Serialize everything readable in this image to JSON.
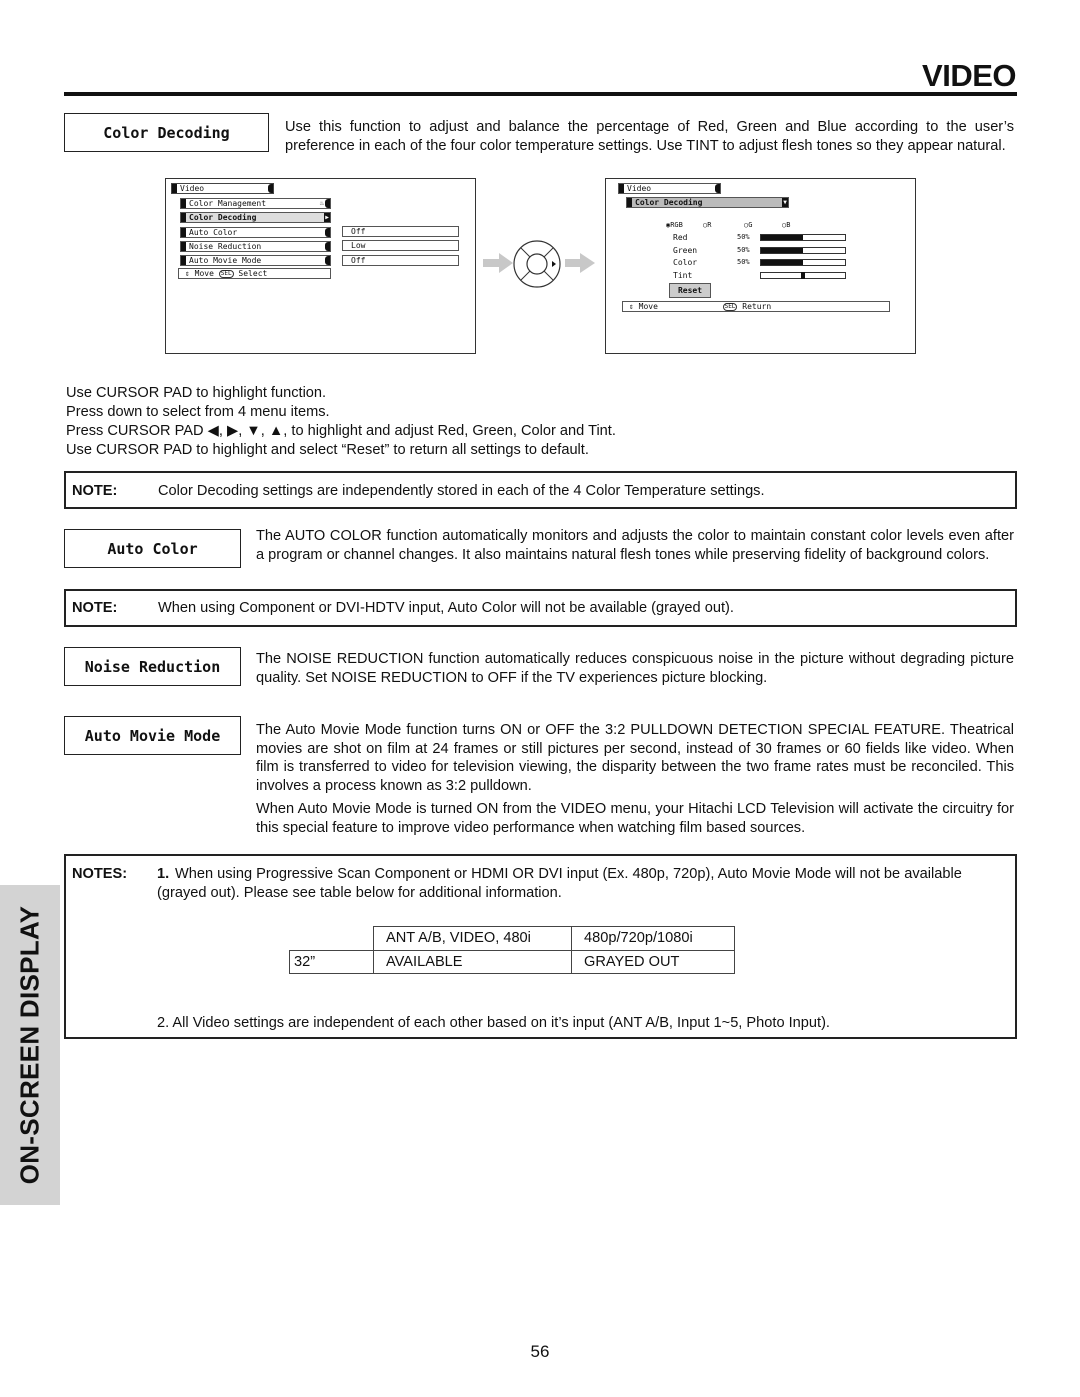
{
  "header": {
    "title": "VIDEO"
  },
  "side_tab": {
    "label": "ON-SCREEN DISPLAY"
  },
  "page_number": "56",
  "sections": {
    "color_decoding": {
      "label": "Color Decoding",
      "description": "Use this function to adjust and balance the percentage of Red, Green and Blue according to the user’s preference in each of the four color temperature settings.  Use TINT to adjust flesh tones so they appear natural."
    },
    "auto_color": {
      "label": "Auto Color",
      "description": "The AUTO COLOR function automatically monitors and adjusts the color to maintain constant color levels even after a program or channel changes. It also maintains natural flesh tones while preserving fidelity of background colors."
    },
    "noise_reduction": {
      "label": "Noise Reduction",
      "description": "The NOISE REDUCTION function automatically reduces conspicuous noise in the picture without degrading picture quality.  Set NOISE REDUCTION to OFF if the TV experiences picture blocking."
    },
    "auto_movie_mode": {
      "label": "Auto Movie Mode",
      "description": "The Auto Movie Mode function turns ON or OFF the 3:2 PULLDOWN DETECTION SPECIAL FEATURE. Theatrical movies are shot on film at 24 frames or still pictures per second, instead of 30 frames or 60 fields like video.  When film is transferred to video for television viewing, the disparity between the two frame rates must be reconciled.  This involves a process known as 3:2 pulldown.",
      "description2": "When Auto Movie Mode is turned ON from the VIDEO menu, your Hitachi LCD Television will activate the circuitry for this special feature to improve video performance when watching film based sources."
    }
  },
  "osd_menu": {
    "title": "Video",
    "items": [
      {
        "label": "Color Management",
        "value": null,
        "icon": "lock-icon"
      },
      {
        "label": "Color Decoding",
        "value": null,
        "icon": "arrow-right-icon"
      },
      {
        "label": "Auto Color",
        "value": "Off"
      },
      {
        "label": "Noise Reduction",
        "value": "Low"
      },
      {
        "label": "Auto Movie Mode",
        "value": "Off"
      }
    ],
    "footer_move": "Move",
    "footer_sel": "SEL",
    "footer_action": "Select"
  },
  "osd_color_decoding": {
    "title": "Video",
    "submenu": "Color Decoding",
    "radio_options": [
      "RGB",
      "R",
      "G",
      "B"
    ],
    "radio_selected": "RGB",
    "sliders": [
      {
        "label": "Red",
        "value_text": "50%",
        "value": 0.5,
        "type": "fill"
      },
      {
        "label": "Green",
        "value_text": "50%",
        "value": 0.5,
        "type": "fill"
      },
      {
        "label": "Color",
        "value_text": "50%",
        "value": 0.5,
        "type": "fill"
      },
      {
        "label": "Tint",
        "value_text": "",
        "value": 0.5,
        "type": "center"
      }
    ],
    "reset_label": "Reset",
    "footer_move": "Move",
    "footer_sel": "SEL",
    "footer_action": "Return"
  },
  "instructions": [
    "Use CURSOR PAD to highlight function.",
    "Press down to select from 4 menu items.",
    "Press CURSOR PAD ◀, ▶, ▼, ▲, to highlight and adjust Red, Green, Color and Tint.",
    "Use CURSOR PAD to highlight and select “Reset” to return all settings to default."
  ],
  "notes": {
    "color_decoding": {
      "label": "NOTE:",
      "text": "Color Decoding settings are independently stored in each of the 4 Color Temperature settings."
    },
    "auto_color": {
      "label": "NOTE:",
      "text": "When using Component or DVI-HDTV input, Auto Color will not be available (grayed out)."
    },
    "auto_movie": {
      "label": "NOTES:",
      "item1_num": "1.",
      "item1": "When using Progressive Scan Component or HDMI OR DVI input (Ex. 480p, 720p), Auto Movie Mode will not be available (grayed out).  Please see table below for additional information.",
      "item2": "2. All Video settings are independent of each other based on it’s input (ANT A/B, Input 1~5, Photo Input)."
    }
  },
  "availability_table": {
    "headers": [
      "",
      "ANT A/B, VIDEO, 480i",
      "480p/720p/1080i"
    ],
    "rows": [
      [
        "32”",
        "AVAILABLE",
        "GRAYED OUT"
      ]
    ]
  }
}
